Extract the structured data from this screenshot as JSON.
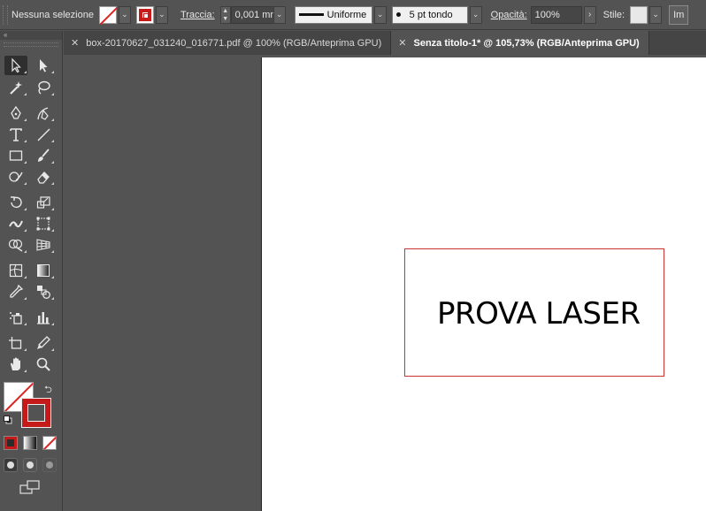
{
  "control_bar": {
    "selection_label": "Nessuna selezione",
    "fill_swatch": "none",
    "stroke_swatch": "red",
    "stroke_label": "Traccia:",
    "stroke_weight": "0,001 mr",
    "brush_profile": "Uniforme",
    "brush_size": "5 pt tondo",
    "opacity_label": "Opacità:",
    "opacity_value": "100%",
    "style_label": "Stile:",
    "cut_button": "Im"
  },
  "tabs": [
    {
      "label": "box-20170627_031240_016771.pdf @ 100% (RGB/Anteprima GPU)",
      "active": false
    },
    {
      "label": "Senza titolo-1* @ 105,73% (RGB/Anteprima GPU)",
      "active": true
    }
  ],
  "toolbar": {
    "collapse_glyph": "«",
    "tools": [
      "selection-tool",
      "direct-selection-tool",
      "magic-wand-tool",
      "lasso-tool",
      "pen-tool",
      "curvature-tool",
      "type-tool",
      "line-segment-tool",
      "rectangle-tool",
      "paintbrush-tool",
      "shaper-tool",
      "eraser-tool",
      "rotate-tool",
      "scale-tool",
      "width-tool",
      "free-transform-tool",
      "shape-builder-tool",
      "perspective-grid-tool",
      "mesh-tool",
      "gradient-tool",
      "eyedropper-tool",
      "blend-tool",
      "symbol-sprayer-tool",
      "column-graph-tool",
      "artboard-tool",
      "slice-tool",
      "hand-tool",
      "zoom-tool"
    ],
    "fill": "none",
    "stroke_color": "#c41a1a"
  },
  "canvas": {
    "text": "PROVA LASER",
    "box_stroke_color": "#c93535"
  }
}
